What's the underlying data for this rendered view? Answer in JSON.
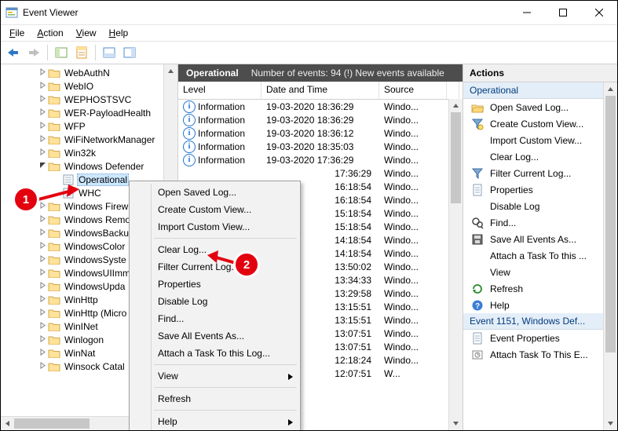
{
  "window": {
    "title": "Event Viewer"
  },
  "menu": {
    "file": "File",
    "action": "Action",
    "view": "View",
    "help": "Help"
  },
  "tree": {
    "items": [
      {
        "depth": 3,
        "twist": "",
        "label": "WebAuthN"
      },
      {
        "depth": 3,
        "twist": "",
        "label": "WebIO"
      },
      {
        "depth": 3,
        "twist": "",
        "label": "WEPHOSTSVC"
      },
      {
        "depth": 3,
        "twist": "",
        "label": "WER-PayloadHealth"
      },
      {
        "depth": 3,
        "twist": "",
        "label": "WFP"
      },
      {
        "depth": 3,
        "twist": "",
        "label": "WiFiNetworkManager"
      },
      {
        "depth": 3,
        "twist": "",
        "label": "Win32k"
      },
      {
        "depth": 3,
        "twist": "v",
        "label": "Windows Defender"
      },
      {
        "depth": 4,
        "twist": "",
        "label": "Operational",
        "kind": "log",
        "selected": true
      },
      {
        "depth": 4,
        "twist": "",
        "label": "WHC",
        "kind": "log"
      },
      {
        "depth": 3,
        "twist": "",
        "label": "Windows Firew"
      },
      {
        "depth": 3,
        "twist": "",
        "label": "Windows Remo"
      },
      {
        "depth": 3,
        "twist": "",
        "label": "WindowsBacku"
      },
      {
        "depth": 3,
        "twist": "",
        "label": "WindowsColor"
      },
      {
        "depth": 3,
        "twist": "",
        "label": "WindowsSyste"
      },
      {
        "depth": 3,
        "twist": "",
        "label": "WindowsUIImm"
      },
      {
        "depth": 3,
        "twist": "",
        "label": "WindowsUpda"
      },
      {
        "depth": 3,
        "twist": "",
        "label": "WinHttp"
      },
      {
        "depth": 3,
        "twist": "",
        "label": "WinHttp (Micro"
      },
      {
        "depth": 3,
        "twist": "",
        "label": "WinINet"
      },
      {
        "depth": 3,
        "twist": "",
        "label": "Winlogon"
      },
      {
        "depth": 3,
        "twist": "",
        "label": "WinNat"
      },
      {
        "depth": 3,
        "twist": "",
        "label": "Winsock Catal"
      }
    ]
  },
  "mid": {
    "barName": "Operational",
    "barInfo": "Number of events: 94 (!) New events available",
    "cols": {
      "level": "Level",
      "dt": "Date and Time",
      "source": "Source"
    },
    "infoLabel": "Information",
    "srcText": "Windo...",
    "srcTextLast": "W...",
    "rows": [
      {
        "full": true,
        "dt": "19-03-2020 18:36:29"
      },
      {
        "full": true,
        "dt": "19-03-2020 18:36:29"
      },
      {
        "full": true,
        "dt": "19-03-2020 18:36:12"
      },
      {
        "full": true,
        "dt": "19-03-2020 18:35:03"
      },
      {
        "full": true,
        "dt": "19-03-2020 17:36:29"
      },
      {
        "full": false,
        "dt": "17:36:29"
      },
      {
        "full": false,
        "dt": "16:18:54"
      },
      {
        "full": false,
        "dt": "16:18:54"
      },
      {
        "full": false,
        "dt": "15:18:54"
      },
      {
        "full": false,
        "dt": "15:18:54"
      },
      {
        "full": false,
        "dt": "14:18:54"
      },
      {
        "full": false,
        "dt": "14:18:54"
      },
      {
        "full": false,
        "dt": "13:50:02"
      },
      {
        "full": false,
        "dt": "13:34:33"
      },
      {
        "full": false,
        "dt": "13:29:58"
      },
      {
        "full": false,
        "dt": "13:15:51"
      },
      {
        "full": false,
        "dt": "13:15:51"
      },
      {
        "full": false,
        "dt": "13:07:51"
      },
      {
        "full": false,
        "dt": "13:07:51"
      },
      {
        "full": false,
        "dt": "12:18:24"
      },
      {
        "full": false,
        "dt": "12:07:51",
        "last": true
      }
    ]
  },
  "actions": {
    "header": "Actions",
    "sub1": "Operational",
    "items1": [
      {
        "icon": "open",
        "label": "Open Saved Log..."
      },
      {
        "icon": "funnel-new",
        "label": "Create Custom View..."
      },
      {
        "icon": "none",
        "label": "Import Custom View..."
      },
      {
        "icon": "none",
        "label": "Clear Log..."
      },
      {
        "icon": "funnel",
        "label": "Filter Current Log..."
      },
      {
        "icon": "props",
        "label": "Properties"
      },
      {
        "icon": "none",
        "label": "Disable Log"
      },
      {
        "icon": "find",
        "label": "Find..."
      },
      {
        "icon": "disk",
        "label": "Save All Events As..."
      },
      {
        "icon": "none",
        "label": "Attach a Task To this ..."
      },
      {
        "icon": "none",
        "label": "View",
        "sub": true
      },
      {
        "icon": "refresh",
        "label": "Refresh"
      },
      {
        "icon": "help",
        "label": "Help",
        "sub": true
      }
    ],
    "sub2": "Event 1151, Windows Def...",
    "items2": [
      {
        "icon": "props",
        "label": "Event Properties"
      },
      {
        "icon": "task",
        "label": "Attach Task To This E..."
      }
    ]
  },
  "ctx": {
    "items": [
      {
        "t": "Open Saved Log..."
      },
      {
        "t": "Create Custom View..."
      },
      {
        "t": "Import Custom View..."
      },
      {
        "sep": true
      },
      {
        "t": "Clear Log..."
      },
      {
        "t": "Filter Current Log..."
      },
      {
        "t": "Properties"
      },
      {
        "t": "Disable Log"
      },
      {
        "t": "Find..."
      },
      {
        "t": "Save All Events As..."
      },
      {
        "t": "Attach a Task To this Log..."
      },
      {
        "sep": true
      },
      {
        "t": "View",
        "sub": true
      },
      {
        "sep": true
      },
      {
        "t": "Refresh"
      },
      {
        "sep": true
      },
      {
        "t": "Help",
        "sub": true
      }
    ]
  },
  "callouts": {
    "c1": "1",
    "c2": "2"
  }
}
